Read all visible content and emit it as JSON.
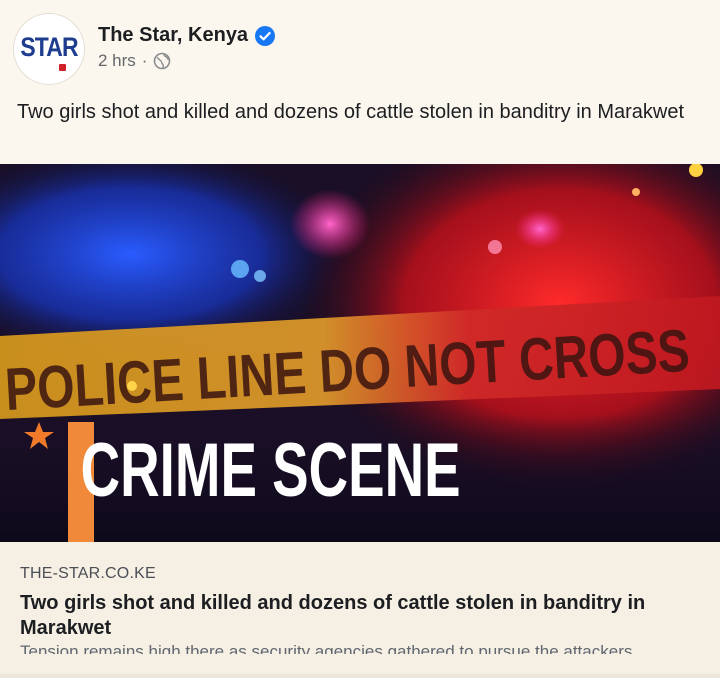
{
  "post": {
    "page_name": "The Star, Kenya",
    "avatar_text": "STAR",
    "time": "2 hrs",
    "separator": "·",
    "verified_icon": "verified-badge-icon",
    "privacy_icon": "globe-icon",
    "text": "Two girls shot and killed and dozens of cattle stolen in banditry in Marakwet"
  },
  "image": {
    "tape_text": "POLICE LINE DO NOT CROSS",
    "caption": "CRIME SCENE",
    "colors": {
      "blue_light": "#1a4cff",
      "red_light": "#e0141e",
      "tape": "#e7a91c",
      "caption": "#ffffff"
    }
  },
  "link": {
    "domain": "THE-STAR.CO.KE",
    "title": "Two girls shot and killed and dozens of cattle stolen in banditry in Marakwet",
    "description": "Tension remains high there as security agencies gathered to pursue the attackers"
  },
  "colors": {
    "verified": "#1877f2",
    "brand_blue": "#1f3d8f",
    "brand_red": "#d0202a"
  }
}
